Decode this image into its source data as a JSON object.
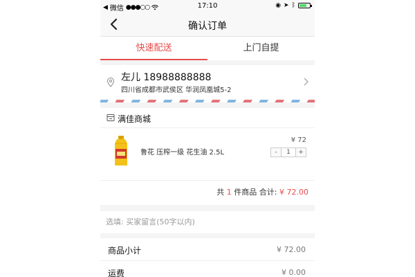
{
  "status_bar": {
    "carrier": "微信",
    "signal": "●●●○○",
    "time": "17:10"
  },
  "nav": {
    "title": "确认订单"
  },
  "tabs": [
    {
      "label": "快速配送",
      "active": true
    },
    {
      "label": "上门自提",
      "active": false
    }
  ],
  "address": {
    "name_phone": "左儿 18988888888",
    "detail": "四川省成都市武侯区 华润凤凰城5-2"
  },
  "shop": {
    "name": "满佳商城",
    "product": {
      "name": "鲁花 压榨一级 花生油 2.5L",
      "price": "¥ 72",
      "quantity": "1",
      "minus": "-",
      "plus": "+"
    },
    "summary": {
      "prefix": "共",
      "count": "1",
      "middle": "件商品 合计:",
      "total": "¥ 72.00"
    }
  },
  "message": {
    "placeholder": "选填: 买家留言(50字以内)"
  },
  "totals": [
    {
      "label": "商品小计",
      "value": "¥ 72.00"
    },
    {
      "label": "运费",
      "value": "¥ 0.00"
    }
  ],
  "colors": {
    "accent": "#e94b4b",
    "battery": "#4cd964"
  }
}
